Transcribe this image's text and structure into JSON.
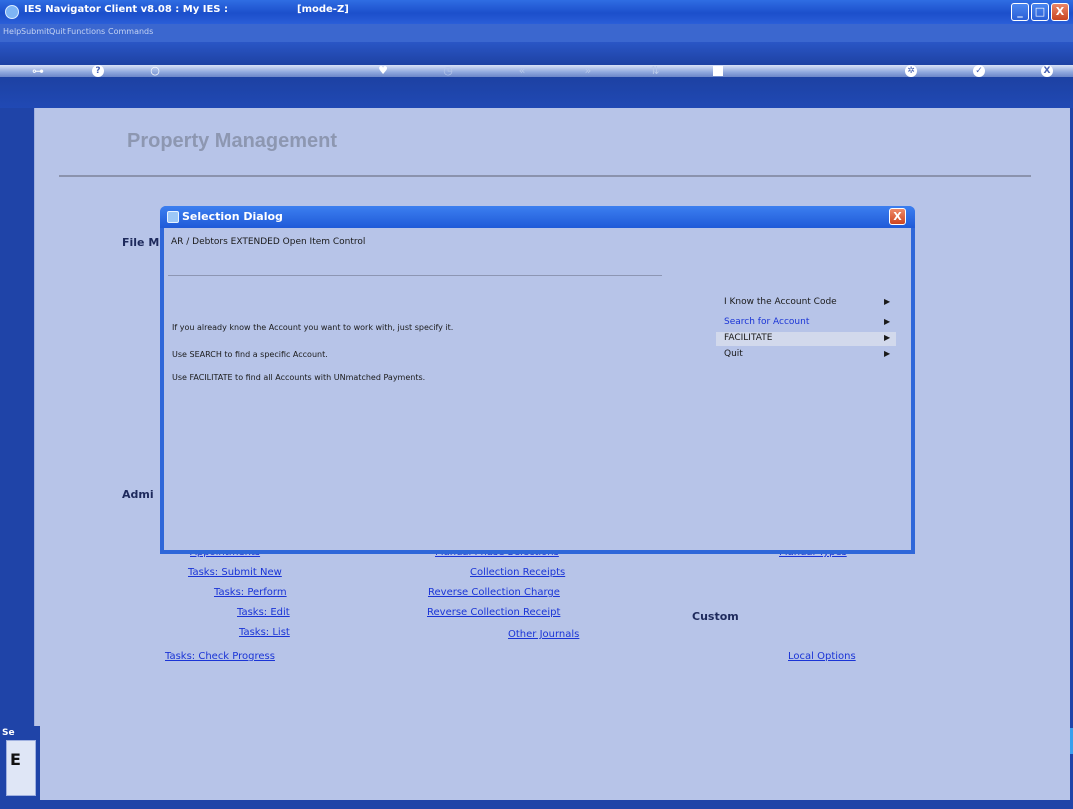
{
  "window": {
    "title": "IES Navigator Client v8.08 : My IES :",
    "mode": "[mode-Z]",
    "controls": {
      "minimize": "_",
      "maximize": "□",
      "close": "X"
    }
  },
  "menubar": [
    "Help",
    "Submit",
    "Quit",
    "Functions",
    "Commands"
  ],
  "toolbar": {
    "icons": [
      "key-icon",
      "help-icon",
      "search-icon",
      "heart-icon",
      "clock-icon",
      "back-icon",
      "forward-icon",
      "sort-icon",
      "stop-icon",
      "settings-icon",
      "ok-icon",
      "close-icon"
    ],
    "help_glyph": "?",
    "ok_glyph": "✓",
    "close_glyph": "X"
  },
  "page": {
    "title": "Property Management",
    "sections": {
      "file": "File M",
      "admin": "Admi",
      "custom": "Custom"
    },
    "links_col1": [
      "Appointments",
      "Tasks: Submit New",
      "Tasks: Perform",
      "Tasks: Edit",
      "Tasks: List",
      "Tasks: Check Progress"
    ],
    "links_col2": [
      "Manual Phase Selections",
      "Collection Receipts",
      "Reverse Collection Charge",
      "Reverse Collection Receipt",
      "Other Journals"
    ],
    "links_col3": [
      "Manual Types",
      "Local Options"
    ]
  },
  "bottom_panel": {
    "label": "Se",
    "letter": "E"
  },
  "dialog": {
    "title": "Selection Dialog",
    "subject": "AR / Debtors EXTENDED Open Item Control",
    "hints": [
      "If you already know the Account you want to work with, just specify it.",
      "Use SEARCH to find a specific Account.",
      "Use FACILITATE to find all Accounts with UNmatched Payments."
    ],
    "menu": [
      {
        "label": "I Know the Account Code",
        "state": "normal"
      },
      {
        "label": "Search for Account",
        "state": "highlight"
      },
      {
        "label": "FACILITATE",
        "state": "selected"
      },
      {
        "label": "Quit",
        "state": "normal"
      }
    ],
    "arrow": "▶",
    "close_glyph": "X"
  }
}
